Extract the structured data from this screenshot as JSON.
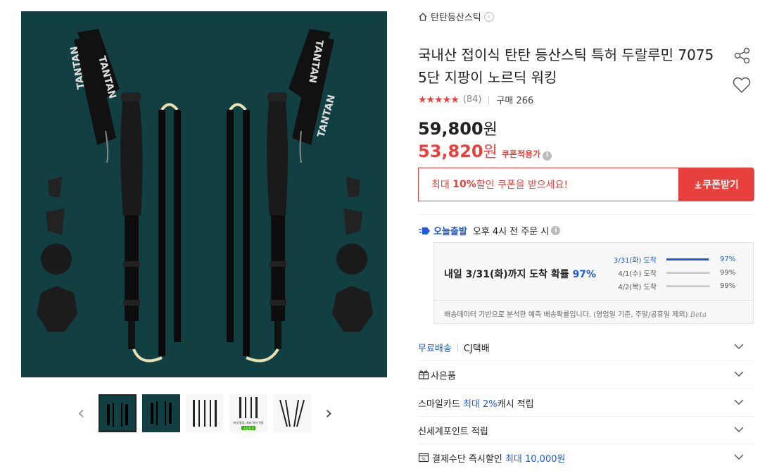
{
  "product": {
    "brand": "탄탄등산스틱",
    "title": "국내산 접이식 탄탄 등산스틱 특허 두랄루민 7075 5단 지팡이 노르딕 워킹",
    "rating_stars": "★★★★★",
    "rating_count": "(84)",
    "purchase_label": "구매 266",
    "price_original": "59,800",
    "price_sale": "53,820",
    "currency": "원",
    "coupon_applied_label": "쿠폰적용가"
  },
  "coupon": {
    "text_prefix": "최대 ",
    "text_bold": "10%",
    "text_suffix": " 할인 쿠폰을 받으세요!",
    "button_label": "쿠폰받기"
  },
  "delivery": {
    "today_label": "오늘출발",
    "today_desc": "오후 4시 전 주문 시",
    "main_prefix": "내일 3/31(화)까지 도착 확률 ",
    "main_pct": "97%",
    "rows": [
      {
        "label": "3/31(화) 도착",
        "pct": "97%",
        "value": 0.97
      },
      {
        "label": "4/1(수) 도착",
        "pct": "99%",
        "value": 0.99
      },
      {
        "label": "4/2(목) 도착",
        "pct": "99%",
        "value": 0.99
      }
    ],
    "note": "배송데이터 기반으로 분석한 예측 배송확률입니다. (영업일 기준, 주말/공휴일 제외)",
    "beta": "Beta"
  },
  "accordion": {
    "shipping_free": "무료배송",
    "shipping_carrier": "CJ택배",
    "gift": "사은품",
    "smilecard_prefix": "스마일카드 ",
    "smilecard_highlight": "최대 2%",
    "smilecard_suffix": " 캐시 적립",
    "shinsegae": "신세계포인트 적립",
    "payment_prefix": "결제수단 즉시할인 ",
    "payment_highlight": "최대 10,000원"
  },
  "thumb_text": {
    "caption": "최대 평점, 최대 특허 적용",
    "badge": "쇼핑119"
  },
  "colors": {
    "accent_red": "#e8403c",
    "accent_blue": "#1a5adb",
    "hero_bg": "#123f42"
  }
}
